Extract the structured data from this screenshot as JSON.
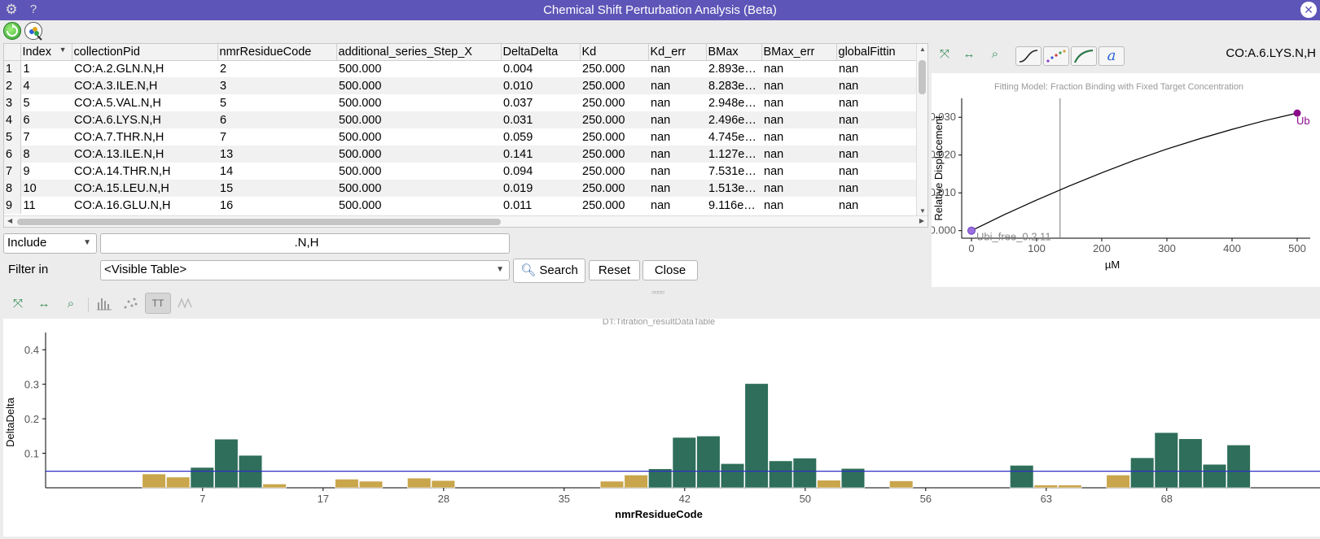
{
  "window": {
    "title": "Chemical Shift Perturbation Analysis (Beta)"
  },
  "table": {
    "columns": [
      "Index",
      "collectionPid",
      "nmrResidueCode",
      "additional_series_Step_X",
      "DeltaDelta",
      "Kd",
      "Kd_err",
      "BMax",
      "BMax_err",
      "globalFittin"
    ],
    "rows": [
      {
        "num": "1",
        "cells": [
          "1",
          "CO:A.2.GLN.N,H",
          "2",
          "500.000",
          "0.004",
          "250.000",
          "nan",
          "2.893e…",
          "nan",
          "nan"
        ]
      },
      {
        "num": "2",
        "cells": [
          "4",
          "CO:A.3.ILE.N,H",
          "3",
          "500.000",
          "0.010",
          "250.000",
          "nan",
          "8.283e…",
          "nan",
          "nan"
        ]
      },
      {
        "num": "3",
        "cells": [
          "5",
          "CO:A.5.VAL.N,H",
          "5",
          "500.000",
          "0.037",
          "250.000",
          "nan",
          "2.948e…",
          "nan",
          "nan"
        ]
      },
      {
        "num": "4",
        "cells": [
          "6",
          "CO:A.6.LYS.N,H",
          "6",
          "500.000",
          "0.031",
          "250.000",
          "nan",
          "2.496e…",
          "nan",
          "nan"
        ]
      },
      {
        "num": "5",
        "cells": [
          "7",
          "CO:A.7.THR.N,H",
          "7",
          "500.000",
          "0.059",
          "250.000",
          "nan",
          "4.745e…",
          "nan",
          "nan"
        ]
      },
      {
        "num": "6",
        "cells": [
          "8",
          "CO:A.13.ILE.N,H",
          "13",
          "500.000",
          "0.141",
          "250.000",
          "nan",
          "1.127e…",
          "nan",
          "nan"
        ]
      },
      {
        "num": "7",
        "cells": [
          "9",
          "CO:A.14.THR.N,H",
          "14",
          "500.000",
          "0.094",
          "250.000",
          "nan",
          "7.531e…",
          "nan",
          "nan"
        ]
      },
      {
        "num": "8",
        "cells": [
          "10",
          "CO:A.15.LEU.N,H",
          "15",
          "500.000",
          "0.019",
          "250.000",
          "nan",
          "1.513e…",
          "nan",
          "nan"
        ]
      },
      {
        "num": "9",
        "cells": [
          "11",
          "CO:A.16.GLU.N,H",
          "16",
          "500.000",
          "0.011",
          "250.000",
          "nan",
          "9.116e…",
          "nan",
          "nan"
        ]
      }
    ]
  },
  "filter": {
    "mode": "Include",
    "text": ".N,H",
    "filter_in_label": "Filter in",
    "filter_in_value": "<Visible Table>",
    "search_label": "Search",
    "reset_label": "Reset",
    "close_label": "Close"
  },
  "fit_panel": {
    "selected_pid": "CO:A.6.LYS.N,H",
    "chart_title": "Fitting Model: Fraction Binding with Fixed Target Concentration"
  },
  "bar_panel": {
    "chart_title": "DT:Titration_resultDataTable"
  },
  "colors": {
    "titlebar": "#5e55b8",
    "bar_above": "#2e6e5a",
    "bar_below": "#c9a54b",
    "threshold": "#2d2fc8",
    "fit_point": "#8a0a8a",
    "fit_start_point": "#9b6fe0"
  },
  "chart_data": [
    {
      "type": "line",
      "title": "Fitting Model: Fraction Binding with Fixed Target Concentration",
      "xlabel": "µM",
      "ylabel": "Relative Displacement",
      "xlim": [
        -15,
        520
      ],
      "ylim": [
        -0.002,
        0.035
      ],
      "x_ticks": [
        "0",
        "100",
        "200",
        "300",
        "400",
        "500"
      ],
      "y_ticks": [
        "0.000",
        "0.010",
        "0.020",
        "0.030"
      ],
      "vline_x": 136,
      "curve": {
        "x": [
          0,
          50,
          100,
          150,
          200,
          250,
          300,
          350,
          400,
          450,
          500
        ],
        "y": [
          0.0,
          0.0042,
          0.0081,
          0.0118,
          0.0153,
          0.0186,
          0.0216,
          0.0243,
          0.0268,
          0.0291,
          0.0311
        ]
      },
      "points": [
        {
          "x": 0,
          "y": 0.0,
          "label": "Ubi_free_0.2.11"
        },
        {
          "x": 500,
          "y": 0.0311,
          "label": "Ub"
        }
      ]
    },
    {
      "type": "bar",
      "title": "DT:Titration_resultDataTable",
      "xlabel": "nmrResidueCode",
      "ylabel": "DeltaDelta",
      "ylim": [
        0,
        0.45
      ],
      "y_ticks": [
        "0.1",
        "0.2",
        "0.3",
        "0.4"
      ],
      "x_tick_labels": [
        "7",
        "17",
        "28",
        "35",
        "42",
        "50",
        "56",
        "63",
        "68"
      ],
      "x_tick_index": [
        5,
        10,
        15,
        20,
        25,
        30,
        35,
        40,
        45
      ],
      "threshold": 0.048,
      "values": [
        0,
        0,
        0,
        0.04,
        0.031,
        0.059,
        0.141,
        0.094,
        0.011,
        0,
        0,
        0.025,
        0.019,
        0,
        0.028,
        0.021,
        0,
        0,
        0,
        0,
        0,
        0,
        0.019,
        0.037,
        0.055,
        0.146,
        0.15,
        0.07,
        0.302,
        0.078,
        0.086,
        0.022,
        0.056,
        0,
        0.02,
        0,
        0,
        0,
        0,
        0.065,
        0.008,
        0.008,
        0,
        0.037,
        0.087,
        0.16,
        0.142,
        0.068,
        0.124,
        0,
        0
      ]
    }
  ]
}
